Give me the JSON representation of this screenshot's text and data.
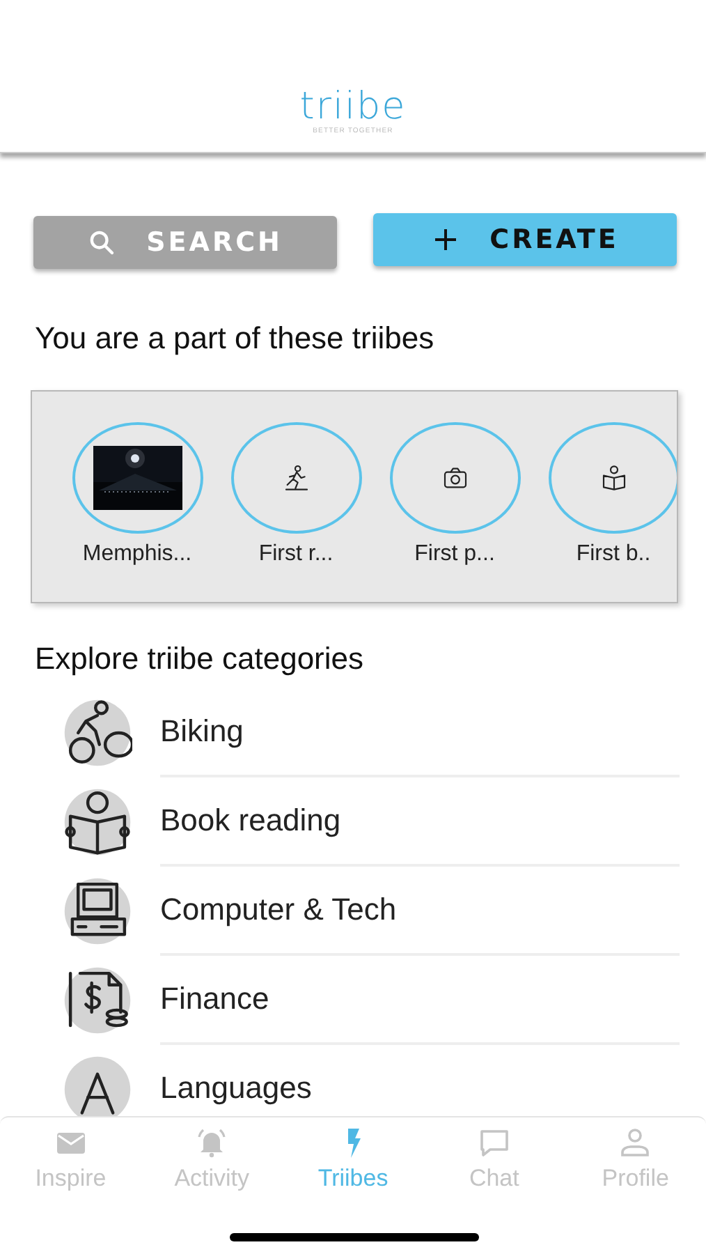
{
  "header": {
    "logo": "triibe",
    "tagline": "BETTER TOGETHER"
  },
  "actions": [
    {
      "kind": "search",
      "label": "SEARCH"
    },
    {
      "kind": "create",
      "label": "CREATE"
    }
  ],
  "my_triibes": {
    "title": "You are a part of these triibes",
    "items": [
      {
        "label": "Memphis...",
        "kind": "picture"
      },
      {
        "label": "First r...",
        "kind": "runner"
      },
      {
        "label": "First p...",
        "kind": "camera"
      },
      {
        "label": "First b..",
        "kind": "reader"
      }
    ]
  },
  "categories": {
    "title": "Explore triibe categories",
    "items": [
      {
        "label": "Biking",
        "kind": "bike"
      },
      {
        "label": "Book reading",
        "kind": "book"
      },
      {
        "label": "Computer & Tech",
        "kind": "computer"
      },
      {
        "label": "Finance",
        "kind": "finance"
      },
      {
        "label": "Languages",
        "kind": "language"
      }
    ]
  },
  "tabs": [
    {
      "label": "Inspire",
      "kind": "mail",
      "selected": false
    },
    {
      "label": "Activity",
      "kind": "bell",
      "selected": false
    },
    {
      "label": "Triibes",
      "kind": "bolt",
      "selected": true
    },
    {
      "label": "Chat",
      "kind": "chat",
      "selected": false
    },
    {
      "label": "Profile",
      "kind": "person",
      "selected": false
    }
  ]
}
